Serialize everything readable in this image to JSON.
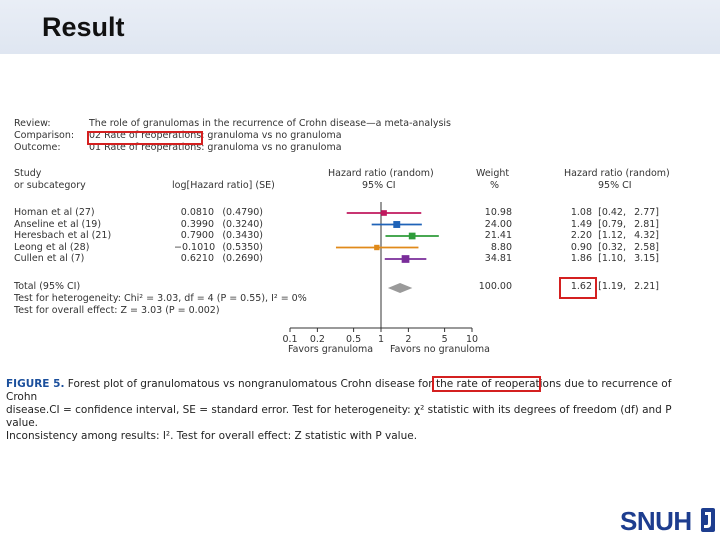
{
  "slide": {
    "title": "Result"
  },
  "meta": {
    "review_label": "Review:",
    "review_value": "The role of granulomas in the recurrence of Crohn disease—a meta-analysis",
    "comparison_label": "Comparison:",
    "comparison_value": "02 Rate of reoperations: granuloma vs no granuloma",
    "outcome_label": "Outcome:",
    "outcome_value": "01 Rate of reoperations: granuloma vs no granuloma"
  },
  "columns": {
    "study_1": "Study",
    "study_2": "or subcategory",
    "loghr": "log[Hazard ratio] (SE)",
    "hr_plot_1": "Hazard ratio (random)",
    "hr_plot_2": "95% CI",
    "weight_1": "Weight",
    "weight_2": "%",
    "hr_text_1": "Hazard ratio (random)",
    "hr_text_2": "95% CI"
  },
  "rows": [
    {
      "study": "Homan et al (27)",
      "loghr": "0.0810",
      "se": "(0.4790)",
      "weight": "10.98",
      "hr": "1.08",
      "ci_low": "[0.42,",
      "ci_high": "2.77]"
    },
    {
      "study": "Anseline et al (19)",
      "loghr": "0.3990",
      "se": "(0.3240)",
      "weight": "24.00",
      "hr": "1.49",
      "ci_low": "[0.79,",
      "ci_high": "2.81]"
    },
    {
      "study": "Heresbach et al (21)",
      "loghr": "0.7900",
      "se": "(0.3430)",
      "weight": "21.41",
      "hr": "2.20",
      "ci_low": "[1.12,",
      "ci_high": "4.32]"
    },
    {
      "study": "Leong et al (28)",
      "loghr": "−0.1010",
      "se": "(0.5350)",
      "weight": "8.80",
      "hr": "0.90",
      "ci_low": "[0.32,",
      "ci_high": "2.58]"
    },
    {
      "study": "Cullen et al (7)",
      "loghr": "0.6210",
      "se": "(0.2690)",
      "weight": "34.81",
      "hr": "1.86",
      "ci_low": "[1.10,",
      "ci_high": "3.15]"
    }
  ],
  "total": {
    "label": "Total (95% CI)",
    "weight": "100.00",
    "hr": "1.62",
    "ci_low": "[1.19,",
    "ci_high": "2.21]",
    "heterogeneity": "Test for heterogeneity: Chi² = 3.03, df = 4 (P = 0.55), I² = 0%",
    "overall": "Test for overall effect: Z = 3.03 (P = 0.002)"
  },
  "axis": {
    "ticks": [
      "0.1",
      "0.2",
      "0.5",
      "1",
      "2",
      "5",
      "10"
    ],
    "left_label": "Favors granuloma",
    "right_label": "Favors no granuloma"
  },
  "caption": {
    "figure_label": "FIGURE 5.",
    "text_1": " Forest plot of granulomatous vs nongranulomatous Crohn disease for the rate of reoperations due to recurrence of Crohn",
    "text_2": "disease.CI = confidence interval, SE = standard error. Test for heterogeneity: χ² statistic with its degrees of freedom (df) and P value.",
    "text_3": "Inconsistency among results: I². Test for overall effect: Z statistic with P value."
  },
  "logo": {
    "text": "SNUH"
  },
  "chart_data": {
    "type": "forest",
    "scale": "log",
    "xlim": [
      0.1,
      10
    ],
    "reference_line": 1,
    "series": [
      {
        "name": "Homan et al (27)",
        "hr": 1.08,
        "lo": 0.42,
        "hi": 2.77,
        "weight": 10.98,
        "color": "#c0185e"
      },
      {
        "name": "Anseline et al (19)",
        "hr": 1.49,
        "lo": 0.79,
        "hi": 2.81,
        "weight": 24.0,
        "color": "#1f63b8"
      },
      {
        "name": "Heresbach et al (21)",
        "hr": 2.2,
        "lo": 1.12,
        "hi": 4.32,
        "weight": 21.41,
        "color": "#2e9c3a"
      },
      {
        "name": "Leong et al (28)",
        "hr": 0.9,
        "lo": 0.32,
        "hi": 2.58,
        "weight": 8.8,
        "color": "#e08a1a"
      },
      {
        "name": "Cullen et al (7)",
        "hr": 1.86,
        "lo": 1.1,
        "hi": 3.15,
        "weight": 34.81,
        "color": "#7a2d9a"
      }
    ],
    "pooled": {
      "hr": 1.62,
      "lo": 1.19,
      "hi": 2.21
    }
  },
  "colors": {
    "highlight": "#d42020",
    "caption_label": "#1b4f9c",
    "diamond": "#9a9a9a"
  }
}
